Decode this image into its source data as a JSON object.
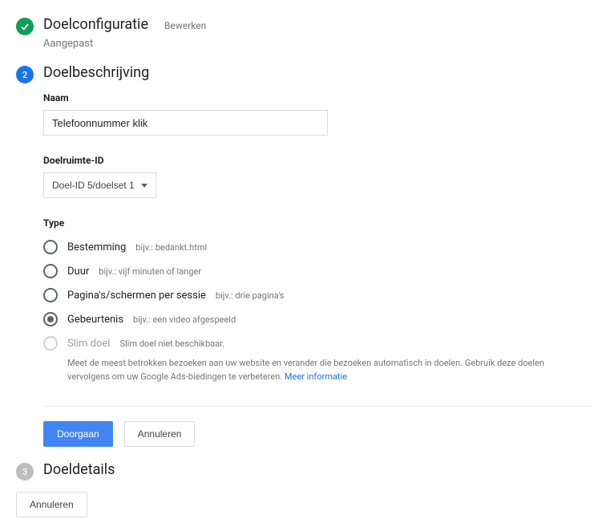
{
  "step1": {
    "title": "Doelconfiguratie",
    "edit": "Bewerken",
    "subtitle": "Aangepast"
  },
  "step2": {
    "badge": "2",
    "title": "Doelbeschrijving",
    "name_label": "Naam",
    "name_value": "Telefoonnummer klik",
    "slot_label": "Doelruimte-ID",
    "slot_value": "Doel-ID 5/doelset 1",
    "type_label": "Type",
    "types": {
      "destination": {
        "label": "Bestemming",
        "hint": "bijv.: bedankt.html"
      },
      "duration": {
        "label": "Duur",
        "hint": "bijv.: vijf minuten of langer"
      },
      "pages": {
        "label": "Pagina's/schermen per sessie",
        "hint": "bijv.: drie pagina's"
      },
      "event": {
        "label": "Gebeurtenis",
        "hint": "bijv.: een video afgespeeld"
      },
      "smart": {
        "label": "Slim doel",
        "hint": "Slim doel niet beschikbaar."
      }
    },
    "smart_desc": "Meet de meest betrokken bezoeken aan uw website en verander die bezoeken automatisch in doelen. Gebruik deze doelen vervolgens om uw Google Ads-biedingen te verbeteren. ",
    "smart_link": "Meer informatie",
    "continue": "Doorgaan",
    "cancel": "Annuleren"
  },
  "step3": {
    "badge": "3",
    "title": "Doeldetails"
  },
  "bottom": {
    "cancel": "Annuleren"
  }
}
